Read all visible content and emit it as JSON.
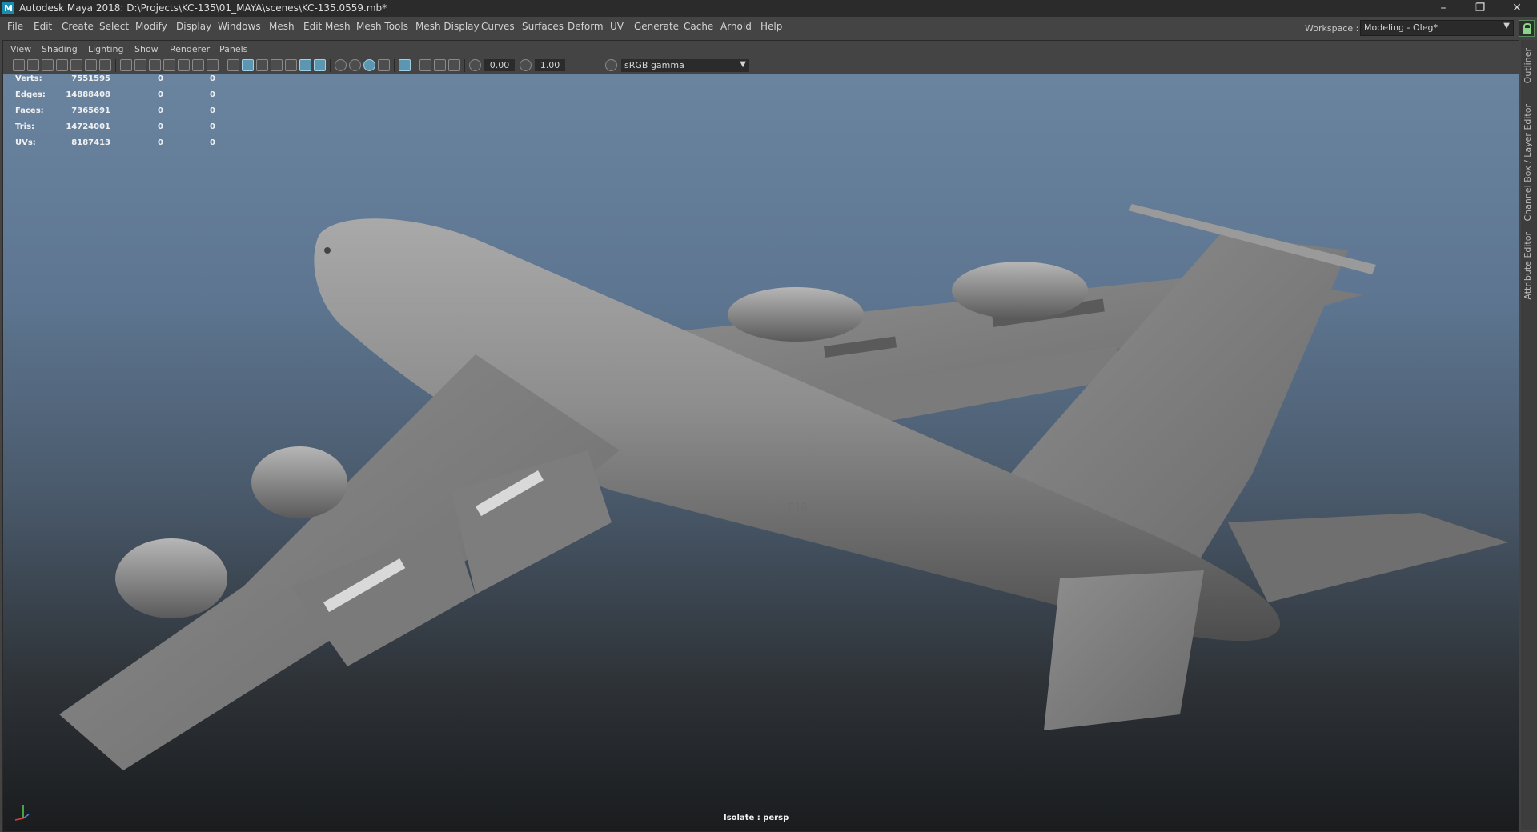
{
  "window": {
    "title": "Autodesk Maya 2018: D:\\Projects\\KC-135\\01_MAYA\\scenes\\KC-135.0559.mb*",
    "app_icon": "M",
    "controls": [
      "–",
      "❐",
      "✕"
    ]
  },
  "menubar": {
    "items": [
      "File",
      "Edit",
      "Create",
      "Select",
      "Modify",
      "Display",
      "Windows",
      "Mesh",
      "Edit Mesh",
      "Mesh Tools",
      "Mesh Display",
      "Curves",
      "Surfaces",
      "Deform",
      "UV",
      "Generate",
      "Cache",
      "Arnold",
      "Help"
    ]
  },
  "workspace": {
    "label": "Workspace :",
    "value": "Modeling - Oleg*",
    "arrow": "▼"
  },
  "panel_menu": {
    "items": [
      "View",
      "Shading",
      "Lighting",
      "Show",
      "Renderer",
      "Panels"
    ]
  },
  "toolbar": {
    "exposure": "0.00",
    "gamma": "1.00",
    "colorspace": "sRGB gamma",
    "colorspace_arrow": "▼"
  },
  "hud": {
    "rows": [
      {
        "label": "Verts:",
        "v1": "7551595",
        "v2": "0",
        "v3": "0"
      },
      {
        "label": "Edges:",
        "v1": "14888408",
        "v2": "0",
        "v3": "0"
      },
      {
        "label": "Faces:",
        "v1": "7365691",
        "v2": "0",
        "v3": "0"
      },
      {
        "label": "Tris:",
        "v1": "14724001",
        "v2": "0",
        "v3": "0"
      },
      {
        "label": "UVs:",
        "v1": "8187413",
        "v2": "0",
        "v3": "0"
      }
    ]
  },
  "viewport": {
    "isolate_label": "Isolate : persp",
    "fuselage_text": "616"
  },
  "side_tabs": [
    "Outliner",
    "Channel Box / Layer Editor",
    "Attribute Editor"
  ],
  "colors": {
    "maya_blue": "#1c8bb0",
    "lock_green": "#8bd38b"
  }
}
